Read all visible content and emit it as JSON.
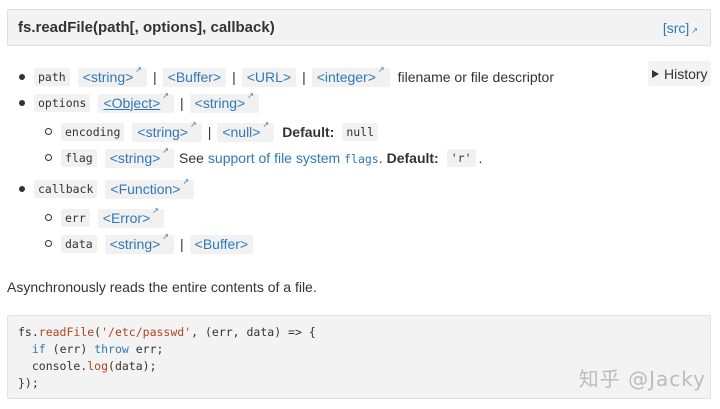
{
  "signature": {
    "title": "fs.readFile(path[, options], callback)",
    "src_label": "[src]"
  },
  "history_label": "History",
  "params": {
    "path": {
      "name": "path",
      "types": [
        "<string>",
        "<Buffer>",
        "<URL>",
        "<integer>"
      ],
      "description": "filename or file descriptor"
    },
    "options": {
      "name": "options",
      "types": [
        "<Object>",
        "<string>"
      ],
      "encoding": {
        "name": "encoding",
        "types": [
          "<string>",
          "<null>"
        ],
        "default_label": "Default:",
        "default_value": "null"
      },
      "flag": {
        "name": "flag",
        "types": [
          "<string>"
        ],
        "see": "See",
        "see_link": "support of file system",
        "see_code": "flags",
        "period": ".",
        "default_label": "Default:",
        "default_value": "'r'",
        "end": "."
      }
    },
    "callback": {
      "name": "callback",
      "types": [
        "<Function>"
      ],
      "err": {
        "name": "err",
        "types": [
          "<Error>"
        ]
      },
      "data": {
        "name": "data",
        "types": [
          "<string>",
          "<Buffer>"
        ]
      }
    }
  },
  "separator": "|",
  "description": "Asynchronously reads the entire contents of a file.",
  "code": {
    "l1_a": "fs.",
    "l1_fn": "readFile",
    "l1_b": "(",
    "l1_str": "'/etc/passwd'",
    "l1_c": ", (err, data) => {",
    "l2_a": "  ",
    "l2_if": "if",
    "l2_b": " (err) ",
    "l2_throw": "throw",
    "l2_c": " err;",
    "l3_a": "  console.",
    "l3_fn": "log",
    "l3_b": "(data);",
    "l4": "});"
  },
  "watermark": "知乎 @Jacky"
}
